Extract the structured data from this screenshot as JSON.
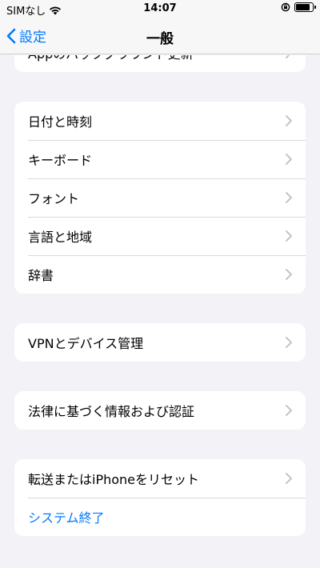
{
  "status": {
    "carrier": "SIMなし",
    "time": "14:07",
    "battery_level": 0.85
  },
  "nav": {
    "back_label": "設定",
    "title": "一般"
  },
  "groups": [
    {
      "items": [
        {
          "label": "Appのバックグラウンド更新"
        }
      ]
    },
    {
      "items": [
        {
          "label": "日付と時刻"
        },
        {
          "label": "キーボード"
        },
        {
          "label": "フォント"
        },
        {
          "label": "言語と地域"
        },
        {
          "label": "辞書"
        }
      ]
    },
    {
      "items": [
        {
          "label": "VPNとデバイス管理"
        }
      ]
    },
    {
      "items": [
        {
          "label": "法律に基づく情報および認証"
        }
      ]
    },
    {
      "items": [
        {
          "label": "転送またはiPhoneをリセット"
        },
        {
          "label": "システム終了"
        }
      ]
    }
  ],
  "colors": {
    "accent": "#007aff",
    "background": "#f2f2f7",
    "chevron": "#c4c4c7"
  }
}
